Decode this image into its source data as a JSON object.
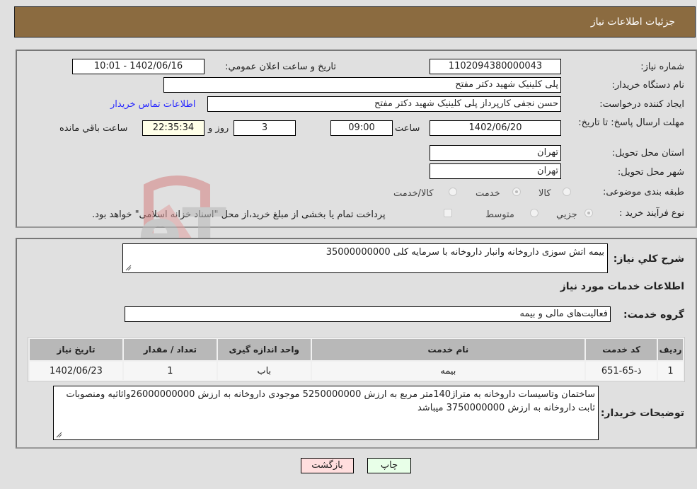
{
  "header": {
    "title": "جزئیات اطلاعات نیاز"
  },
  "form": {
    "need_number": {
      "label": "شماره نیاز:",
      "value": "1102094380000043"
    },
    "announce_datetime": {
      "label": "تاریخ و ساعت اعلان عمومي:",
      "value": "1402/06/16 - 10:01"
    },
    "buyer_org": {
      "label": "نام دستگاه خریدار:",
      "value": "پلی کلینیک شهید دکتر مفتح"
    },
    "requester": {
      "label": "ایجاد کننده درخواست:",
      "value": "حسن نجفی کارپرداز پلی کلینیک شهید دکتر مفتح"
    },
    "buyer_contact_link": "اطلاعات تماس خریدار",
    "deadline": {
      "label": "مهلت ارسال پاسخ: تا تاریخ:",
      "date": "1402/06/20",
      "time_label": "ساعت",
      "time": "09:00",
      "days": "3",
      "days_label": "روز و",
      "remaining": "22:35:34",
      "remaining_label": "ساعت باقي مانده"
    },
    "province": {
      "label": "استان محل تحویل:",
      "value": "تهران"
    },
    "city": {
      "label": "شهر محل تحویل:",
      "value": "تهران"
    },
    "category": {
      "label": "طبقه بندی موضوعی:",
      "options": [
        "کالا",
        "خدمت",
        "کالا/خدمت"
      ],
      "selected": "خدمت"
    },
    "purchase_type": {
      "label": "نوع فرآیند خرید :",
      "options": [
        "جزيي",
        "متوسط"
      ],
      "selected": "جزيي",
      "treasury_note": "پرداخت تمام یا بخشی از مبلغ خرید،از محل \"اسناد خزانه اسلامی\" خواهد بود."
    }
  },
  "details": {
    "summary_label": "شرح كلي نياز:",
    "summary_value": "بیمه اتش سوزی داروخانه وانبار داروخانه با سرمایه کلی 35000000000",
    "services_heading": "اطلاعات خدمات مورد نیاز",
    "service_group_label": "گروه خدمت:",
    "service_group_value": "فعالیت‌های مالی و بیمه",
    "table": {
      "headers": [
        "ردیف",
        "کد خدمت",
        "نام خدمت",
        "واحد اندازه گیری",
        "تعداد / مقدار",
        "تاریخ نیاز"
      ],
      "rows": [
        [
          "1",
          "ذ-65-651",
          "بیمه",
          "باب",
          "1",
          "1402/06/23"
        ]
      ]
    },
    "buyer_notes_label": "توضیحات خریدار:",
    "buyer_notes_value": "ساختمان وتاسیسات داروخانه به متراژ140متر مربع به ارزش 5250000000 موجودی داروخانه به ارزش 26000000000واثاثیه ومنصوبات ثابت داروخانه به ارزش 3750000000 میباشد"
  },
  "buttons": {
    "print": "چاپ",
    "back": "بازگشت"
  },
  "watermark": {
    "text": "AriaTender.neT"
  }
}
